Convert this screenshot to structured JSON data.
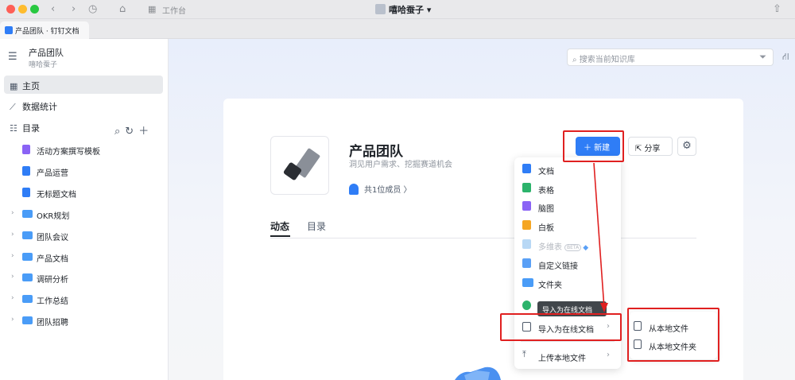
{
  "titlebar": {
    "workbench_label": "工作台",
    "workspace_name": "嘻哈蚕子 ▾"
  },
  "tab": {
    "label": "产品团队 · 钉钉文档"
  },
  "sidebar": {
    "title": "产品团队",
    "subtitle": "嘻哈蚕子",
    "nav": [
      {
        "label": "主页",
        "icon": "grid-icon"
      },
      {
        "label": "数据统计",
        "icon": "chart-icon"
      },
      {
        "label": "目录",
        "icon": "outline-icon"
      }
    ],
    "docs": [
      {
        "label": "活动方案撰写模板",
        "icon": "mindmap-doc-icon",
        "color": "#8a63f5"
      },
      {
        "label": "产品运营",
        "icon": "doc-icon",
        "color": "#2f7df6"
      },
      {
        "label": "无标题文档",
        "icon": "doc-icon",
        "color": "#2f7df6"
      }
    ],
    "folders": [
      {
        "label": "OKR规划"
      },
      {
        "label": "团队会议"
      },
      {
        "label": "产品文档"
      },
      {
        "label": "调研分析"
      },
      {
        "label": "工作总结"
      },
      {
        "label": "团队招聘"
      }
    ]
  },
  "search": {
    "placeholder": "搜索当前知识库"
  },
  "kb": {
    "title": "产品团队",
    "description": "洞见用户需求、挖掘赛道机会",
    "members": "共1位成员 〉",
    "new_label": "＋ 新建",
    "share_label": "⇱ 分享"
  },
  "content_tabs": [
    "动态",
    "目录"
  ],
  "menu": {
    "items": [
      {
        "label": "文档",
        "color": "#2f7df6"
      },
      {
        "label": "表格",
        "color": "#2cb36b"
      },
      {
        "label": "脑图",
        "color": "#8a63f5"
      },
      {
        "label": "白板",
        "color": "#f5a623"
      },
      {
        "label": "多维表",
        "color": "#b8d8f5",
        "badge": "BETA"
      },
      {
        "label": "自定义链接",
        "color": "#5aa0f6"
      },
      {
        "label": "文件夹",
        "color": "#4a9cf7"
      }
    ],
    "import_label": "导入为在线文档",
    "upload_label": "上传本地文件",
    "tooltip": "导入为在线文档"
  },
  "submenu": {
    "items": [
      "从本地文件",
      "从本地文件夹"
    ]
  },
  "colors": {
    "accent": "#2f7df6",
    "highlight": "#e02020"
  }
}
